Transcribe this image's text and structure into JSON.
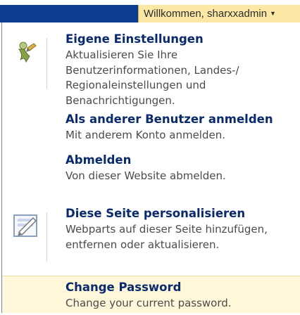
{
  "topbar": {
    "welcome_label": "Willkommen, sharxxadmin",
    "caret": "▼"
  },
  "menu": {
    "items": [
      {
        "title": "Eigene Einstellungen",
        "description": "Aktualisieren Sie Ihre Benutzerinformationen, Landes-/ Regionaleinstellungen und Benachrichtigungen.",
        "icon": "user-settings-icon"
      },
      {
        "title": "Als anderer Benutzer anmelden",
        "description": "Mit anderem Konto anmelden."
      },
      {
        "title": "Abmelden",
        "description": "Von dieser Website abmelden."
      },
      {
        "title": "Diese Seite personalisieren",
        "description": "Webparts auf dieser Seite hinzufügen, entfernen oder aktualisieren.",
        "icon": "edit-page-icon"
      },
      {
        "title": "Change Password",
        "description": "Change your current password."
      }
    ]
  },
  "colors": {
    "header_band": "#0b3e90",
    "welcome_bg": "#fbe8a5",
    "title_text": "#0a2a6e",
    "highlight_bg": "#fff7d9"
  }
}
